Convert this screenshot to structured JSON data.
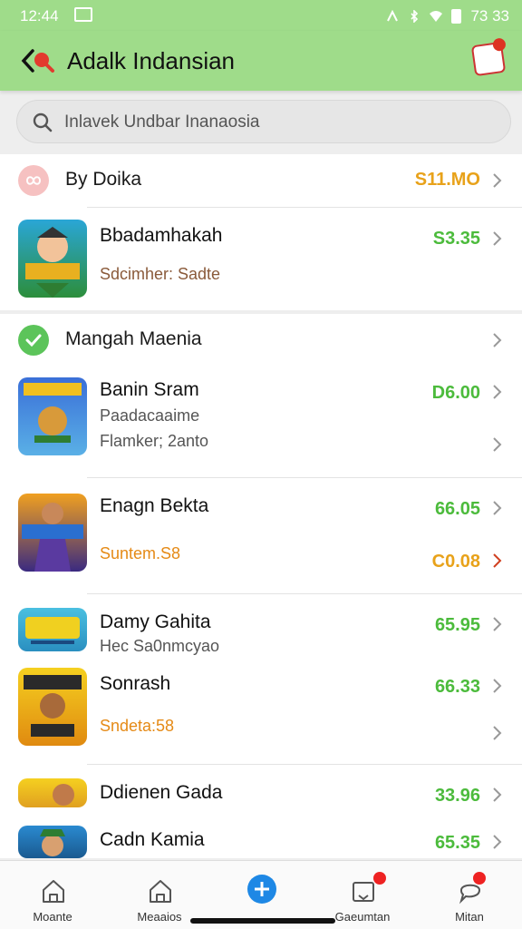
{
  "status": {
    "time": "12:44",
    "right_text": "73 33"
  },
  "appbar": {
    "title": "Adalk Indansian"
  },
  "search": {
    "placeholder": "Inlavek Undbar Inanaosia"
  },
  "section1": {
    "title": "By Doika",
    "price": "S11.MO",
    "items": [
      {
        "name": "Bbadamhakah",
        "sub": "Sdcimher: Sadte",
        "price": "S3.35"
      }
    ]
  },
  "section2": {
    "title": "Mangah Maenia",
    "items": [
      {
        "name": "Banin Sram",
        "sub1": "Paadacaaime",
        "sub2": "Flamker; 2anto",
        "price": "D6.00"
      },
      {
        "name": "Enagn Bekta",
        "sub1": "Suntem.S8",
        "price": "66.05",
        "price2": "C0.08"
      },
      {
        "name": "Damy Gahita",
        "sub1": "Hec Sa0nmcyao",
        "price": "65.95"
      },
      {
        "name": "Sonrash",
        "sub1": "Sndeta:58",
        "price": "66.33"
      },
      {
        "name": "Ddienen Gada",
        "price": "33.96"
      },
      {
        "name": "Cadn Kamia",
        "price": "65.35"
      }
    ]
  },
  "nav": [
    {
      "label": "Moante"
    },
    {
      "label": "Meaaios"
    },
    {
      "label": ""
    },
    {
      "label": "Gaeumtan"
    },
    {
      "label": "Mitan"
    }
  ],
  "colors": {
    "accent_green": "#9fdc8a",
    "price_green": "#4cbb3c",
    "price_orange": "#e8a21a"
  }
}
